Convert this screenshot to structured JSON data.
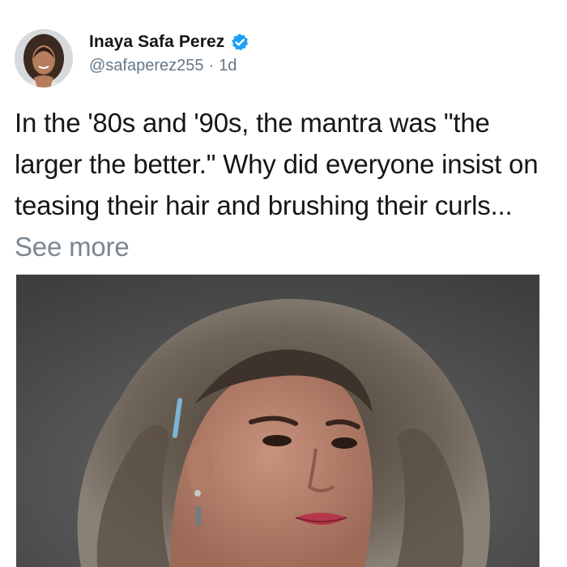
{
  "author": {
    "display_name": "Inaya Safa Perez",
    "handle": "@safaperez255",
    "separator": "·",
    "time": "1d",
    "verified": true,
    "verified_icon": "verified-badge-icon",
    "verified_color": "#1da1f2"
  },
  "tweet": {
    "text": "In the '80s and '90s, the mantra was \"the larger the better.\" Why did everyone insist on teasing their hair and brushing their curls...",
    "see_more_label": "See more"
  },
  "colors": {
    "text": "#14171a",
    "muted": "#657786",
    "see_more": "#7c8790",
    "media_background": "#4f4f4f"
  }
}
